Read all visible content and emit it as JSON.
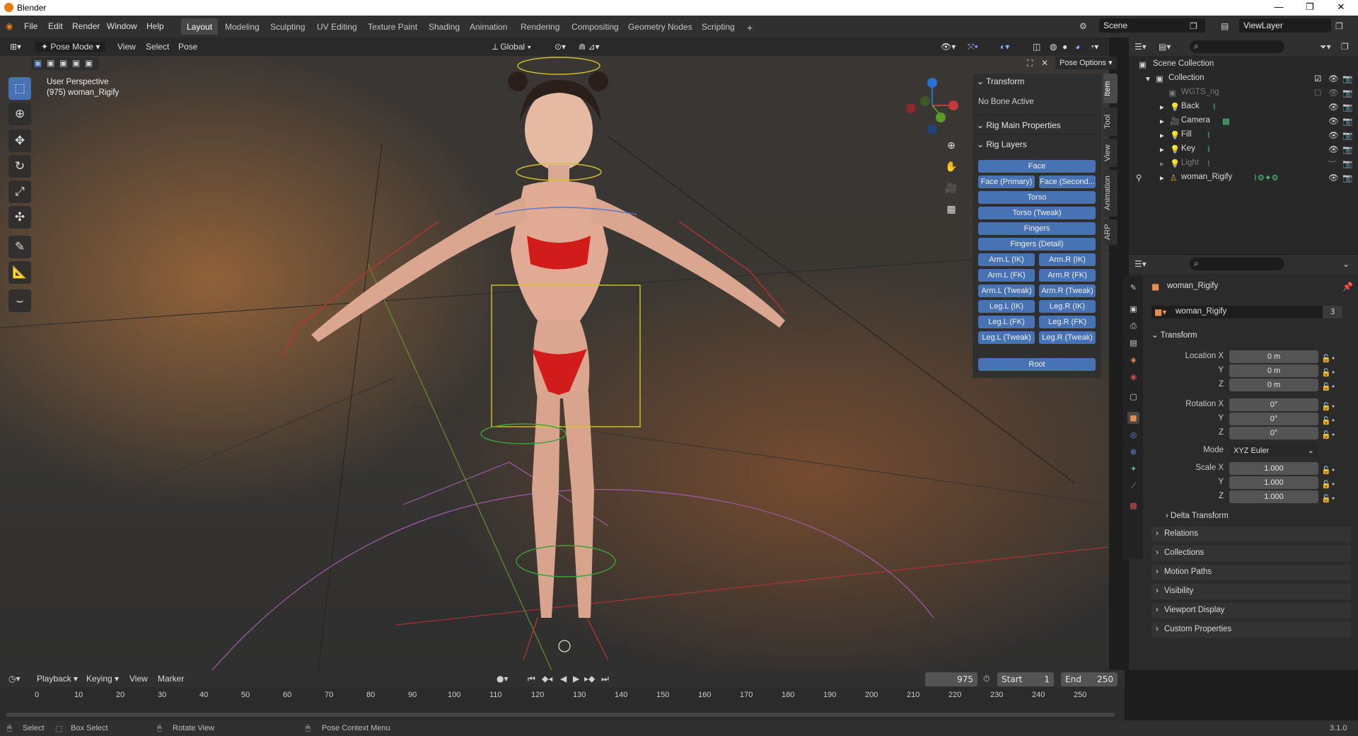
{
  "window": {
    "title": "Blender",
    "minimize": "—",
    "restore": "❐",
    "close": "✕"
  },
  "menu": [
    "File",
    "Edit",
    "Render",
    "Window",
    "Help"
  ],
  "workspaces": [
    "Layout",
    "Modeling",
    "Sculpting",
    "UV Editing",
    "Texture Paint",
    "Shading",
    "Animation",
    "Rendering",
    "Compositing",
    "Geometry Nodes",
    "Scripting"
  ],
  "add_workspace": "+",
  "scene": {
    "label": "Scene",
    "viewlayer": "ViewLayer"
  },
  "viewport_header": {
    "mode": "Pose Mode",
    "items": [
      "View",
      "Select",
      "Pose"
    ],
    "orientation": "Global",
    "pose_options": "Pose Options"
  },
  "viewport": {
    "perspective": "User Perspective",
    "object_info": "(975) woman_Rigify"
  },
  "npanel": {
    "transform_header": "Transform",
    "no_bone": "No Bone Active",
    "rig_main": "Rig Main Properties",
    "rig_layers": "Rig Layers",
    "buttons": {
      "face": "Face",
      "face_primary": "Face (Primary)",
      "face_secondary": "Face (Second...",
      "torso": "Torso",
      "torso_tweak": "Torso (Tweak)",
      "fingers": "Fingers",
      "fingers_detail": "Fingers (Detail)",
      "arm_l_ik": "Arm.L (IK)",
      "arm_r_ik": "Arm.R (IK)",
      "arm_l_fk": "Arm.L (FK)",
      "arm_r_fk": "Arm.R (FK)",
      "arm_l_tweak": "Arm.L (Tweak)",
      "arm_r_tweak": "Arm.R (Tweak)",
      "leg_l_ik": "Leg.L (IK)",
      "leg_r_ik": "Leg.R (IK)",
      "leg_l_fk": "Leg.L (FK)",
      "leg_r_fk": "Leg.R (FK)",
      "leg_l_tweak": "Leg.L (Tweak)",
      "leg_r_tweak": "Leg.R (Tweak)",
      "root": "Root"
    },
    "tabs": [
      "Item",
      "Tool",
      "View",
      "Animation",
      "ARP"
    ]
  },
  "outliner": {
    "rows": [
      {
        "label": "Scene Collection"
      },
      {
        "label": "Collection"
      },
      {
        "label": "WGTS_rig"
      },
      {
        "label": "Back"
      },
      {
        "label": "Camera"
      },
      {
        "label": "Fill"
      },
      {
        "label": "Key"
      },
      {
        "label": "Light"
      },
      {
        "label": "woman_Rigify"
      }
    ]
  },
  "properties": {
    "object_name": "woman_Rigify",
    "datablock": "woman_Rigify",
    "users": "3",
    "transform_header": "Transform",
    "location_x_label": "Location X",
    "y_label": "Y",
    "z_label": "Z",
    "location": [
      "0 m",
      "0 m",
      "0 m"
    ],
    "rotation_x_label": "Rotation X",
    "rotation": [
      "0°",
      "0°",
      "0°"
    ],
    "mode_label": "Mode",
    "mode": "XYZ Euler",
    "scale_x_label": "Scale X",
    "scale": [
      "1.000",
      "1.000",
      "1.000"
    ],
    "subpanels": [
      "Delta Transform",
      "Relations",
      "Collections",
      "Motion Paths",
      "Visibility",
      "Viewport Display",
      "Custom Properties"
    ]
  },
  "timeline": {
    "menus": [
      "Playback",
      "Keying",
      "View",
      "Marker"
    ],
    "current_frame": "975",
    "start_label": "Start",
    "start": "1",
    "end_label": "End",
    "end": "250",
    "ticks": [
      "0",
      "10",
      "20",
      "30",
      "40",
      "50",
      "60",
      "70",
      "80",
      "90",
      "100",
      "110",
      "120",
      "130",
      "140",
      "150",
      "160",
      "170",
      "180",
      "190",
      "200",
      "210",
      "220",
      "230",
      "240",
      "250"
    ]
  },
  "status": {
    "select": "Select",
    "box_select": "Box Select",
    "rotate": "Rotate View",
    "context": "Pose Context Menu",
    "version": "3.1.0"
  },
  "colors": {
    "accent": "#4772b3",
    "bg": "#1d1d1d",
    "panel": "#303030"
  }
}
